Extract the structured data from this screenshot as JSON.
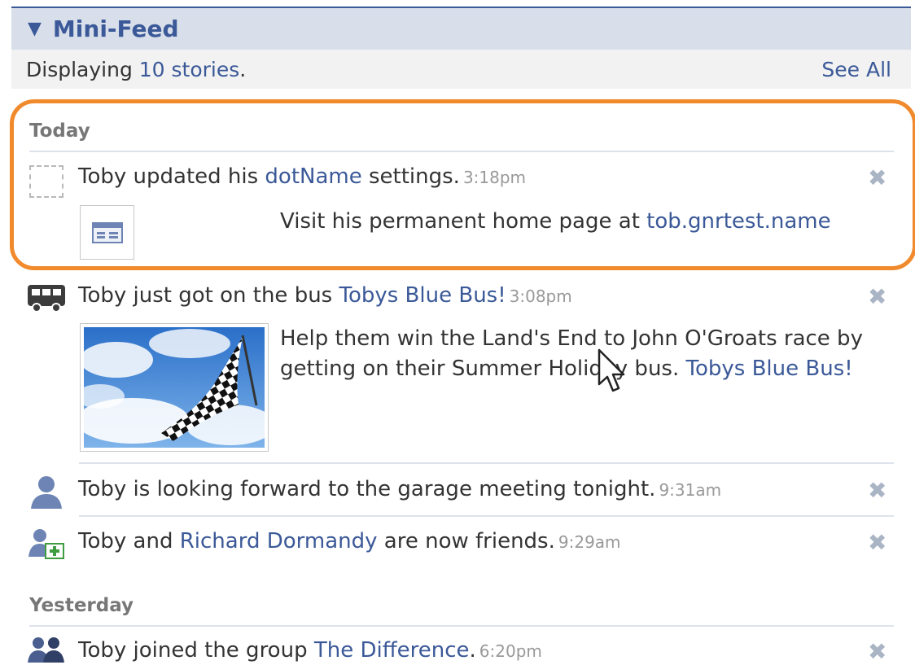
{
  "header": {
    "title": "Mini-Feed"
  },
  "subbar": {
    "prefix": "Displaying ",
    "stories_link": "10 stories",
    "suffix": ".",
    "see_all": "See All"
  },
  "days": {
    "today": "Today",
    "yesterday": "Yesterday"
  },
  "stories": [
    {
      "icon": "dotname-placeholder-icon",
      "actor": "Toby",
      "text1": " updated his ",
      "link1": "dotName",
      "text2": " settings.",
      "time": "3:18pm",
      "attachment": {
        "text": "Visit his permanent home page at ",
        "link": "tob.gnrtest.name"
      }
    },
    {
      "icon": "bus-icon",
      "actor": "Toby",
      "text1": " just got on the bus ",
      "link1": "Tobys Blue Bus!",
      "time": "3:08pm",
      "attachment": {
        "line1": "Help them win the Land's End to John O'Groats race by",
        "line2": "getting on their Summer Holiday bus. ",
        "link": "Tobys Blue Bus!"
      }
    },
    {
      "icon": "person-status-icon",
      "actor": "Toby",
      "text1": " is looking forward to the garage meeting tonight.",
      "time": "9:31am"
    },
    {
      "icon": "friends-add-icon",
      "actor": "Toby",
      "text1": " and ",
      "link1": "Richard Dormandy",
      "text2": " are now friends.",
      "time": "9:29am"
    },
    {
      "icon": "group-icon",
      "actor": "Toby",
      "text1": " joined the group ",
      "link1": "The Difference",
      "text2": ".",
      "time": "6:20pm"
    }
  ],
  "close_glyph": "✖",
  "colors": {
    "link": "#3b5998",
    "highlight": "#f08a2c",
    "header_bg": "#d8dfea"
  }
}
